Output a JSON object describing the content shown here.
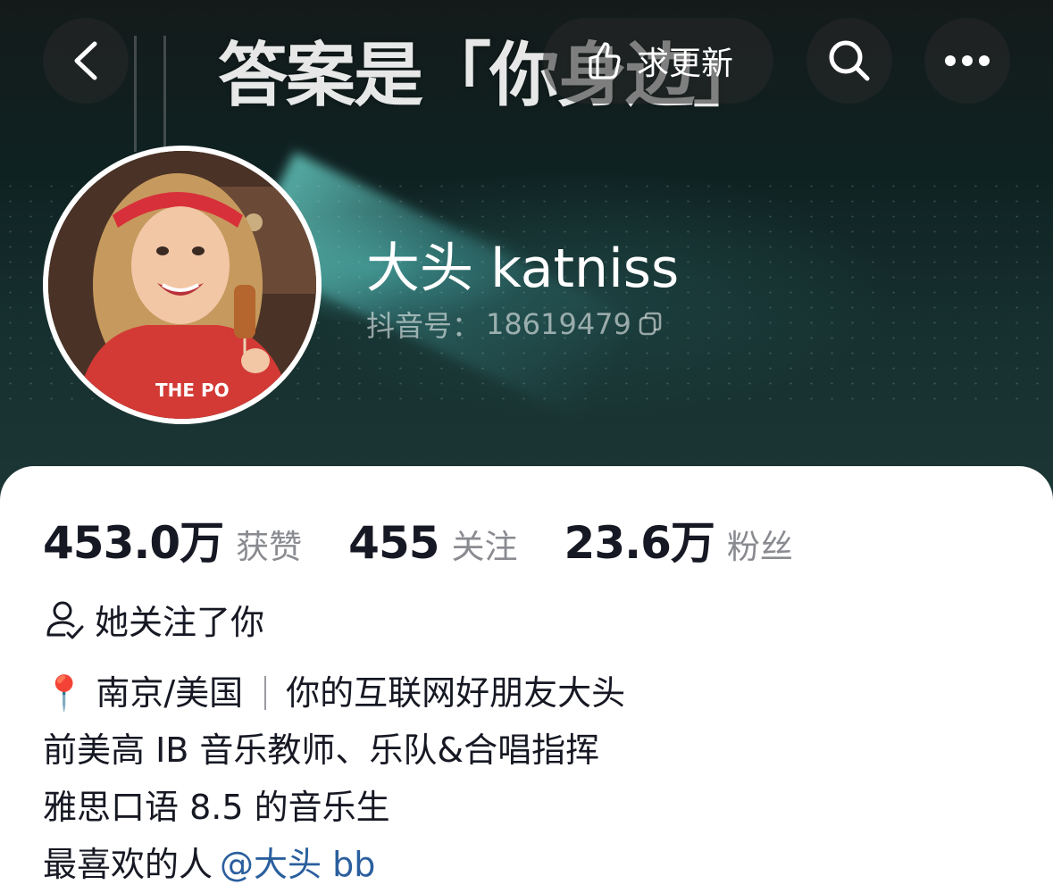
{
  "header": {
    "banner_text": "答案是「你身边」",
    "back_icon": "chevron-left-icon",
    "update_button_label": "求更新",
    "update_icon": "hand-pointing-icon",
    "search_icon": "search-icon",
    "more_icon": "ellipsis-icon"
  },
  "profile": {
    "nickname": "大头 katniss",
    "douyin_id_label": "抖音号：",
    "douyin_id": "18619479",
    "copy_icon": "copy-icon"
  },
  "stats": [
    {
      "value": "453.0万",
      "label": "获赞"
    },
    {
      "value": "455",
      "label": "关注"
    },
    {
      "value": "23.6万",
      "label": "粉丝"
    }
  ],
  "follow_note": "她关注了你",
  "bio": {
    "location_pin": "📍",
    "location": "南京/美国",
    "tagline": "你的互联网好朋友大头",
    "line2": "前美高 IB 音乐教师、乐队&合唱指挥",
    "line3": "雅思口语 8.5 的音乐生",
    "line4_prefix": "最喜欢的人",
    "mention": "@大头 bb"
  },
  "colors": {
    "text_primary": "#161823",
    "text_secondary": "#8a8b91",
    "mention": "#2a5f9e"
  }
}
